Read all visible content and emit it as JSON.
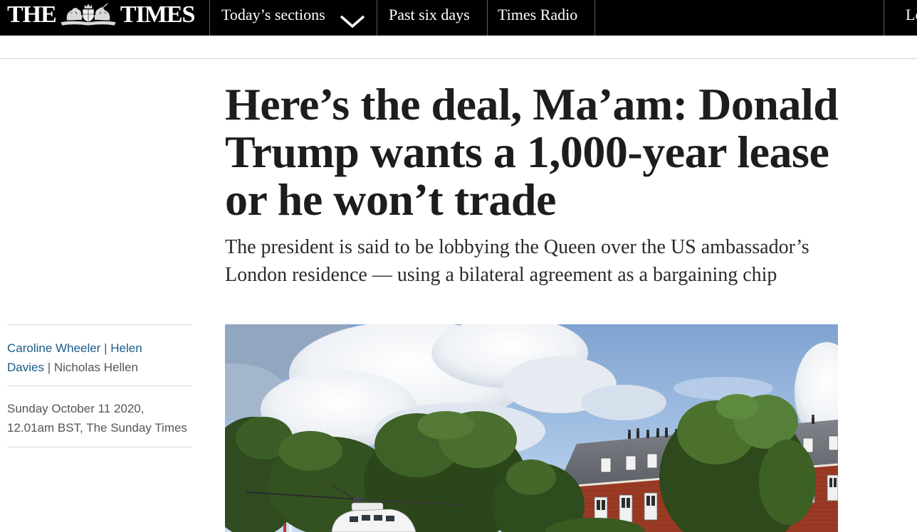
{
  "colors": {
    "nav_background": "#000000",
    "nav_text": "#ffffff",
    "link": "#1a5c8a",
    "headline": "#1d1d1b",
    "muted_text": "#555555",
    "rule": "#d6d6d6"
  },
  "nav": {
    "logo": {
      "word_left": "THE",
      "word_right": "TIMES",
      "crest_icon": "royal-crest-icon"
    },
    "items": [
      {
        "label": "Today’s sections",
        "icon": "chevron-down-icon"
      },
      {
        "label": "Past six days"
      },
      {
        "label": "Times Radio"
      }
    ],
    "login_label": "Lo"
  },
  "article": {
    "headline": "Here’s the deal, Ma’am: Donald Trump wants a 1,000-year lease or he won’t trade",
    "standfirst": "The president is said to be lobbying the Queen over the US ambassador’s London residence — using a bilateral agreement as a bargaining chip",
    "byline": {
      "authors": [
        "Caroline Wheeler",
        "Helen Davies",
        "Nicholas Hellen"
      ],
      "separator": "|"
    },
    "published": {
      "date": "Sunday October 11 2020,",
      "time_publication": "12.01am BST, The Sunday Times"
    }
  }
}
